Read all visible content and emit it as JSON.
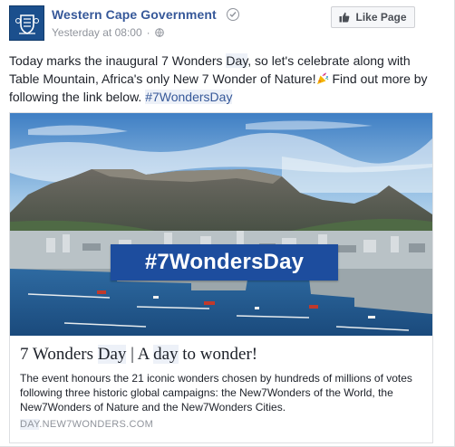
{
  "header": {
    "page_name": "Western Cape Government",
    "timestamp": "Yesterday at 08:00",
    "separator": "·",
    "like_button_label": "Like Page",
    "icons": [
      "coat-of-arms",
      "verified-icon",
      "globe-icon",
      "thumbs-up-icon"
    ]
  },
  "post": {
    "text_part1": "Today marks the inaugural 7 Wonders ",
    "text_day": "Day",
    "text_part2": ", so let's celebrate along with Table Mountain, Africa's only New 7 Wonder of Nature!",
    "text_part3": " Find out more by following the link below. ",
    "hashtag": "#7WondersDay"
  },
  "link_preview": {
    "image_banner": "#7WondersDay",
    "title_part1": "7 Wonders ",
    "title_day": "Day",
    "title_part2": " | A ",
    "title_day2": "day",
    "title_part3": " to wonder!",
    "description": "The event honours the 21 iconic wonders chosen by hundreds of millions of votes following three historic global campaigns: the New7Wonders of the World, the New7Wonders of Nature and the New7Wonders Cities.",
    "domain_part1": "DAY",
    "domain_part2": ".NEW7WONDERS.COM"
  },
  "colors": {
    "link_blue": "#365899",
    "banner_blue": "#1d4d9e",
    "meta_grey": "#90949c",
    "highlight": "#edf1f8"
  }
}
